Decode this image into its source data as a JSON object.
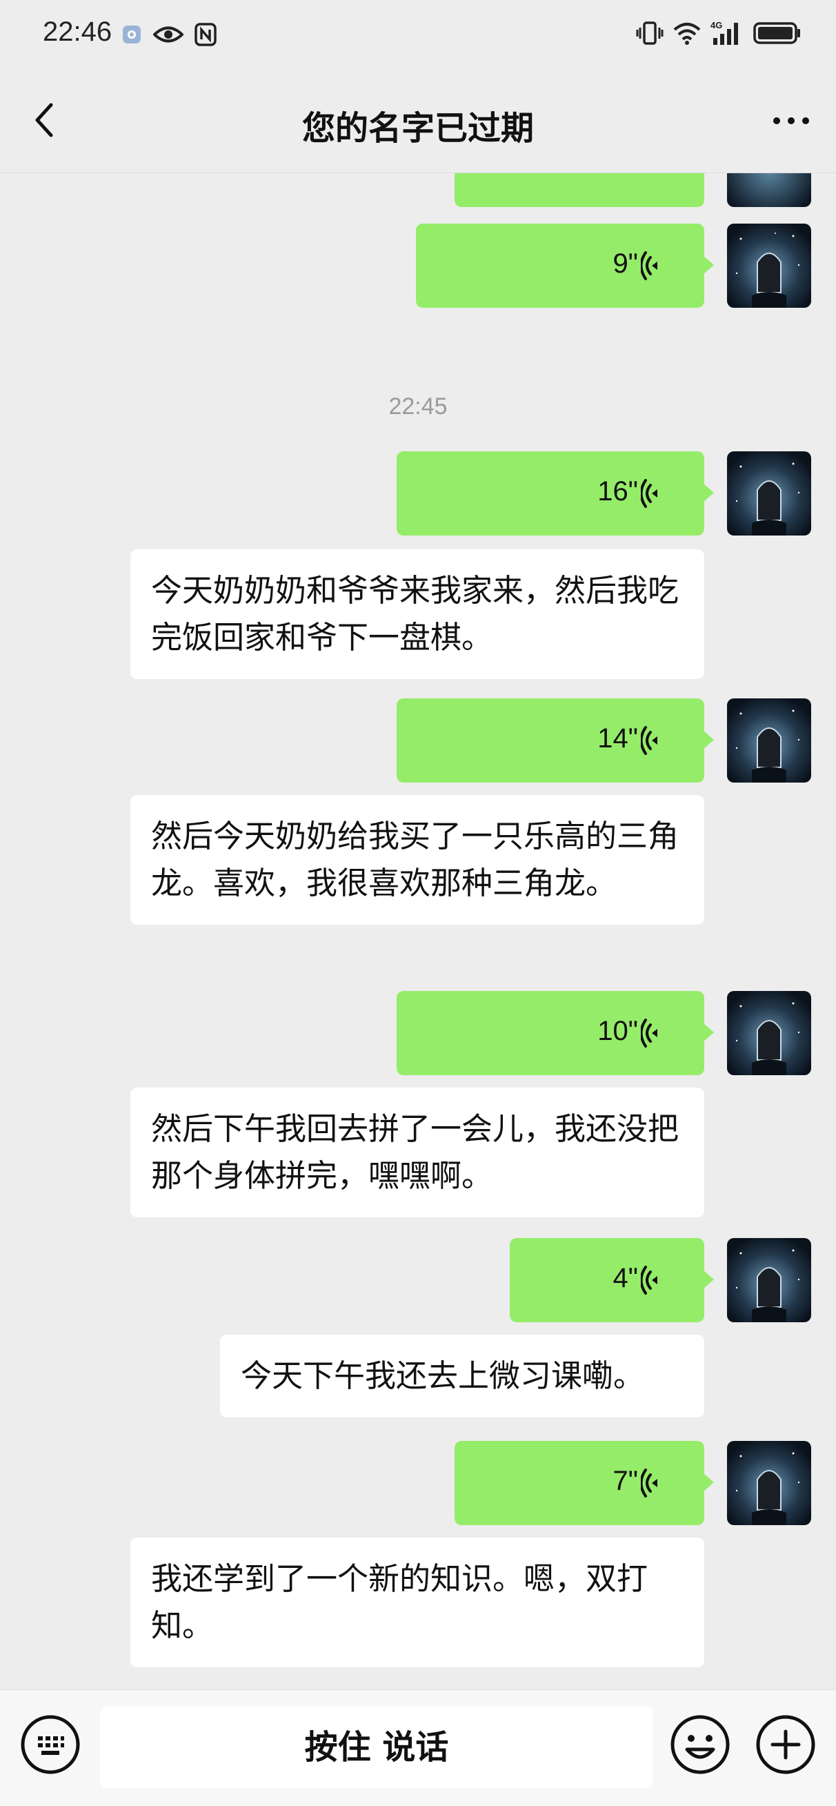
{
  "status_bar": {
    "time": "22:46",
    "icons_left": [
      "app-notification-icon",
      "eye-icon",
      "nfc-icon"
    ],
    "icons_right": [
      "vibrate-icon",
      "wifi-icon",
      "4g-signal-icon",
      "battery-icon"
    ],
    "network_label": "4G"
  },
  "nav": {
    "title": "您的名字已过期",
    "back_icon": "chevron-left-icon",
    "more_icon": "more-dots-icon"
  },
  "colors": {
    "background": "#ededed",
    "voice_bubble": "#95ec69",
    "text_bubble": "#ffffff",
    "timestamp": "#9a9a9a"
  },
  "messages": [
    {
      "type": "voice",
      "duration": "9\""
    },
    {
      "type": "time",
      "text": "22:45"
    },
    {
      "type": "voice",
      "duration": "16\""
    },
    {
      "type": "transcript",
      "text": "今天奶奶奶和爷爷来我家来，然后我吃完饭回家和爷下一盘棋。"
    },
    {
      "type": "voice",
      "duration": "14\""
    },
    {
      "type": "transcript",
      "text": "然后今天奶奶给我买了一只乐高的三角龙。喜欢，我很喜欢那种三角龙。"
    },
    {
      "type": "voice",
      "duration": "10\""
    },
    {
      "type": "transcript",
      "text": "然后下午我回去拼了一会儿，我还没把那个身体拼完，嘿嘿啊。"
    },
    {
      "type": "voice",
      "duration": "4\""
    },
    {
      "type": "transcript",
      "text": "今天下午我还去上微习课嘞。"
    },
    {
      "type": "voice",
      "duration": "7\""
    },
    {
      "type": "transcript",
      "text": "我还学到了一个新的知识。嗯，双打知。"
    }
  ],
  "input_bar": {
    "hold_to_talk_label": "按住 说话",
    "keyboard_icon": "keyboard-icon",
    "emoji_icon": "emoji-icon",
    "plus_icon": "plus-icon"
  }
}
